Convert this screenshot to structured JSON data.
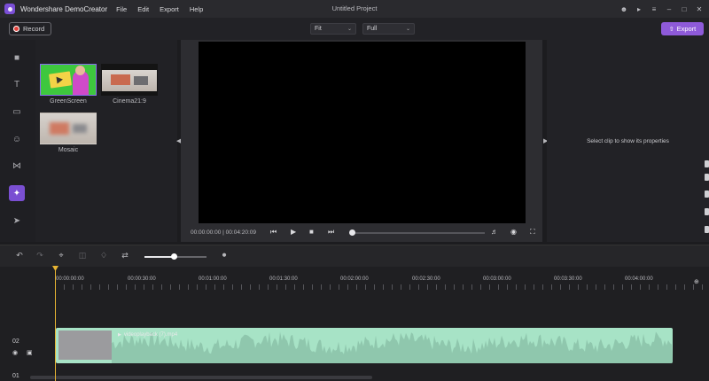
{
  "app": {
    "name": "Wondershare DemoCreator",
    "menus": [
      "File",
      "Edit",
      "Export",
      "Help"
    ],
    "project_title": "Untitled Project"
  },
  "toolbar": {
    "record_label": "Record",
    "fit_value": "Fit",
    "quality_value": "Full",
    "export_label": "Export"
  },
  "sidebar": {
    "items": [
      {
        "icon": "folder-icon"
      },
      {
        "icon": "text-icon"
      },
      {
        "icon": "annotation-icon"
      },
      {
        "icon": "sticker-icon"
      },
      {
        "icon": "transition-icon"
      },
      {
        "icon": "effects-icon",
        "active": true
      },
      {
        "icon": "cursor-effect-icon"
      }
    ]
  },
  "effects": [
    {
      "label": "GreenScreen",
      "selected": true
    },
    {
      "label": "Cinema21:9"
    },
    {
      "label": "Mosaic"
    }
  ],
  "preview": {
    "current_time": "00:00:00:00",
    "total_time": "00:04:20:09",
    "time_separator": "|"
  },
  "properties": {
    "empty_message": "Select clip to show its properties"
  },
  "timeline": {
    "ruler": [
      "00:00:00:00",
      "00:00:30:00",
      "00:01:00:00",
      "00:01:30:00",
      "00:02:00:00",
      "00:02:30:00",
      "00:03:00:00",
      "00:03:30:00",
      "00:04:00:00"
    ],
    "tracks": [
      {
        "number": "02",
        "clip_name": "videoplayback (7).mp4"
      },
      {
        "number": "01"
      }
    ]
  },
  "colors": {
    "accent": "#8e5ad9",
    "clip": "#a7e3c6",
    "playhead": "#e8b433"
  }
}
